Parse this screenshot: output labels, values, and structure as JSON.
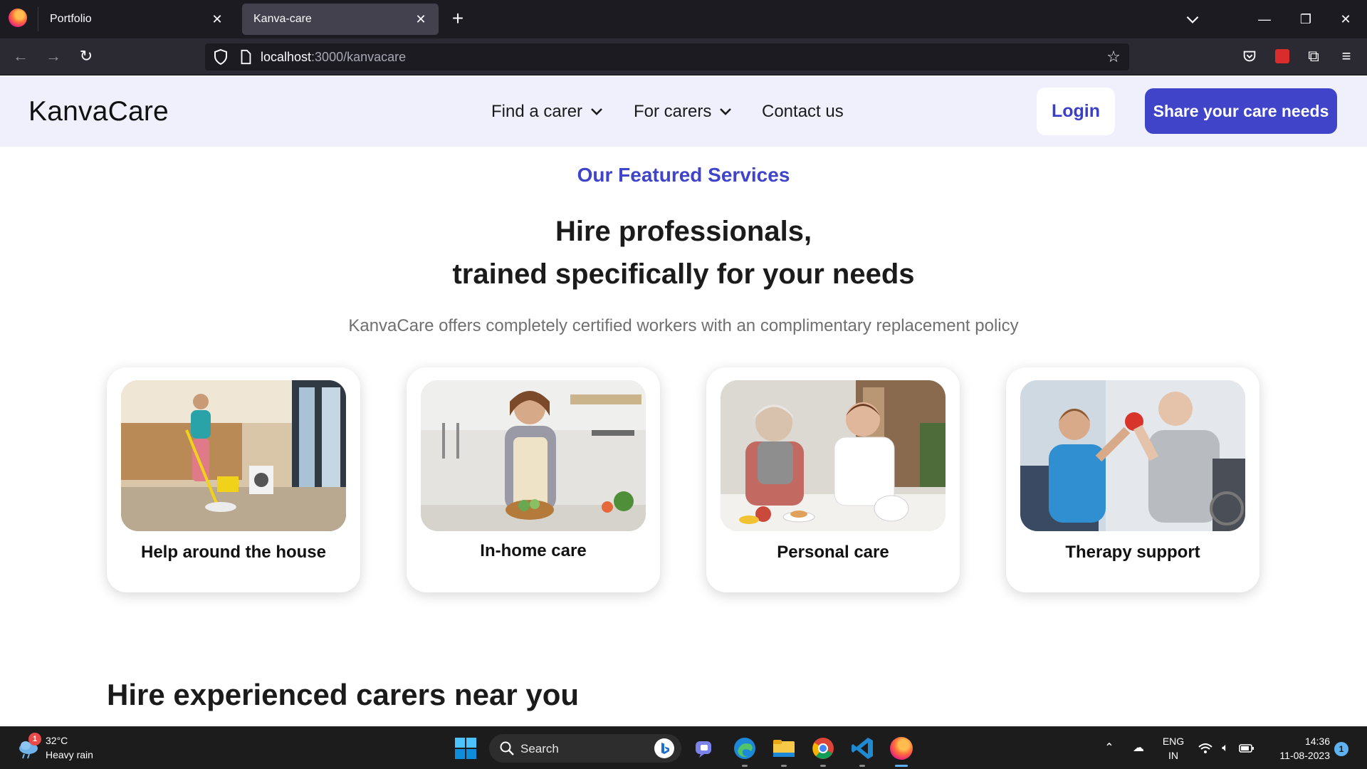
{
  "browser": {
    "tabs": [
      {
        "title": "Portfolio",
        "active": false
      },
      {
        "title": "Kanva-care",
        "active": true
      }
    ],
    "tab_close_glyph": "✕",
    "new_tab_glyph": "+",
    "url_host": "localhost",
    "url_path": ":3000/kanvacare",
    "window_controls": {
      "minimize": "—",
      "restore": "❐",
      "close": "✕"
    }
  },
  "site": {
    "brand": "KanvaCare",
    "nav": [
      {
        "label": "Find a carer",
        "has_dropdown": true
      },
      {
        "label": "For carers",
        "has_dropdown": true
      },
      {
        "label": "Contact us",
        "has_dropdown": false
      }
    ],
    "login_label": "Login",
    "cta_label": "Share your care needs",
    "accent_color": "#4044c8"
  },
  "hero": {
    "kicker": "Our Featured Services",
    "headline_line1": "Hire professionals,",
    "headline_line2": "trained specifically for your needs",
    "subtitle": "KanvaCare offers completely certified workers with an complimentary replacement policy"
  },
  "services": [
    {
      "title": "Help around the house",
      "image": "woman mopping floor in a kitchen"
    },
    {
      "title": "In-home care",
      "image": "smiling woman preparing a salad in a kitchen"
    },
    {
      "title": "Personal care",
      "image": "carer serving tea to an elderly woman"
    },
    {
      "title": "Therapy support",
      "image": "therapist helping an elderly man lift a dumbbell"
    }
  ],
  "section2_title": "Hire experienced carers near you",
  "taskbar": {
    "weather_temp": "32°C",
    "weather_desc": "Heavy rain",
    "weather_badge": "1",
    "search_label": "Search",
    "lang_top": "ENG",
    "lang_bottom": "IN",
    "time": "14:36",
    "date": "11-08-2023",
    "notification_count": "1"
  }
}
